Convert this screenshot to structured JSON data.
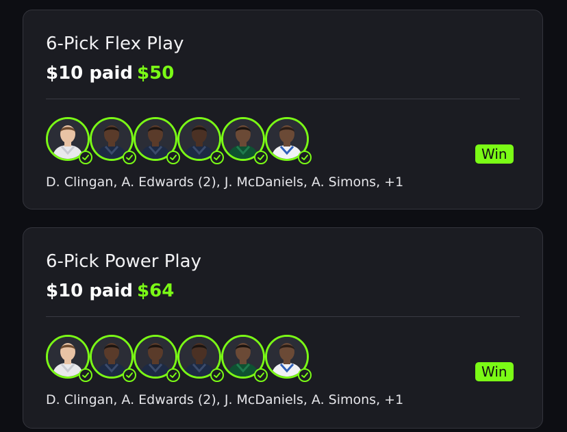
{
  "cards": [
    {
      "title": "6-Pick Flex Play",
      "paid_label": "$10 paid",
      "won_amount": "$50",
      "status": "Win",
      "players_summary": "D. Clingan, A. Edwards (2), J. McDaniels, A. Simons, +1",
      "avatars": [
        {
          "player": "D. Clingan",
          "jersey": "white",
          "status": "hit"
        },
        {
          "player": "A. Edwards",
          "jersey": "navy",
          "status": "hit"
        },
        {
          "player": "A. Edwards",
          "jersey": "navy",
          "status": "hit"
        },
        {
          "player": "J. McDaniels",
          "jersey": "navy",
          "status": "hit"
        },
        {
          "player": "A. Simons",
          "jersey": "green",
          "status": "hit"
        },
        {
          "player": "+1",
          "jersey": "white-blue",
          "status": "hit"
        }
      ]
    },
    {
      "title": "6-Pick Power Play",
      "paid_label": "$10 paid",
      "won_amount": "$64",
      "status": "Win",
      "players_summary": "D. Clingan, A. Edwards (2), J. McDaniels, A. Simons, +1",
      "avatars": [
        {
          "player": "D. Clingan",
          "jersey": "white",
          "status": "hit"
        },
        {
          "player": "A. Edwards",
          "jersey": "navy",
          "status": "hit"
        },
        {
          "player": "A. Edwards",
          "jersey": "navy",
          "status": "hit"
        },
        {
          "player": "J. McDaniels",
          "jersey": "navy",
          "status": "hit"
        },
        {
          "player": "A. Simons",
          "jersey": "green",
          "status": "hit"
        },
        {
          "player": "+1",
          "jersey": "white-blue",
          "status": "hit"
        }
      ]
    }
  ],
  "colors": {
    "accent": "#7bfb16",
    "card_bg": "#1b1c22",
    "page_bg": "#0d0e13"
  }
}
